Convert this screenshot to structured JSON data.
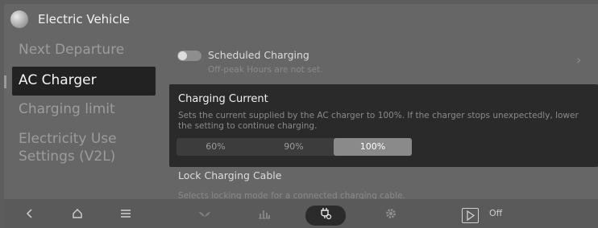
{
  "header": {
    "title": "Electric Vehicle"
  },
  "sidebar": {
    "items": [
      {
        "label": "Next Departure"
      },
      {
        "label": "AC Charger"
      },
      {
        "label": "Charging limit"
      },
      {
        "label": "Electricity Use Settings (V2L)"
      }
    ],
    "active_index": 1
  },
  "main": {
    "scheduled_charging": {
      "label": "Scheduled Charging",
      "sub": "Off-peak Hours are not set.",
      "enabled": false
    },
    "charging_current": {
      "title": "Charging Current",
      "description": "Sets the current supplied by the AC charger to 100%. If the charger stops unexpectedly, lower the setting to continue charging.",
      "options": [
        "60%",
        "90%",
        "100%"
      ],
      "selected": "100%"
    },
    "lock_cable": {
      "title": "Lock Charging Cable",
      "sub": "Selects locking mode for a connected charging cable."
    }
  },
  "bottombar": {
    "icons": [
      "back-icon",
      "home-icon",
      "menu-icon",
      "leaf-icon",
      "bar-chart-icon",
      "ev-charger-icon",
      "gear-icon",
      "play-icon"
    ],
    "play_label": "Off"
  },
  "colors": {
    "background": "#666666",
    "panel": "#2a2a2a",
    "accent": "#8a8a8a"
  }
}
